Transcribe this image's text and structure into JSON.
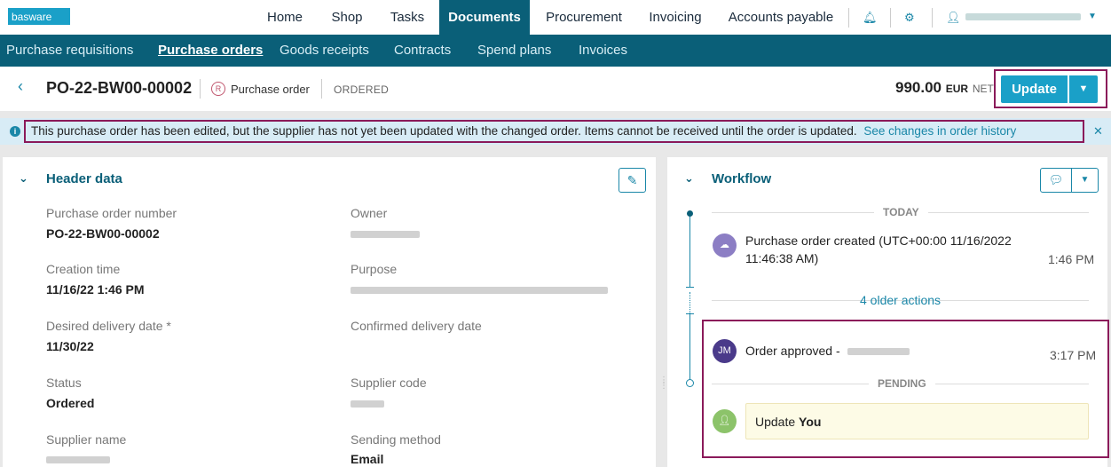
{
  "app": {
    "logo": "basware"
  },
  "topnav": {
    "items": [
      "Home",
      "Shop",
      "Tasks",
      "Documents",
      "Procurement",
      "Invoicing",
      "Accounts payable"
    ],
    "active": "Documents"
  },
  "subnav": {
    "items": [
      "Purchase requisitions",
      "Purchase orders",
      "Goods receipts",
      "Contracts",
      "Spend plans",
      "Invoices"
    ],
    "active": "Purchase orders"
  },
  "document": {
    "number": "PO-22-BW00-00002",
    "type": "Purchase order",
    "status": "ORDERED",
    "amount": "990.00",
    "currency": "EUR",
    "net": "NET",
    "update_label": "Update"
  },
  "banner": {
    "message": "This purchase order has been edited, but the supplier has not yet been updated with the changed order. Items cannot be received until the order is updated.",
    "link": "See changes in order history"
  },
  "header_data": {
    "title": "Header data",
    "fields": {
      "po_number_label": "Purchase order number",
      "po_number": "PO-22-BW00-00002",
      "owner_label": "Owner",
      "creation_label": "Creation time",
      "creation": "11/16/22 1:46 PM",
      "purpose_label": "Purpose",
      "desired_label": "Desired delivery date *",
      "desired": "11/30/22",
      "confirmed_label": "Confirmed delivery date",
      "status_label": "Status",
      "status": "Ordered",
      "supplier_code_label": "Supplier code",
      "supplier_name_label": "Supplier name",
      "sending_label": "Sending method",
      "sending": "Email"
    }
  },
  "workflow": {
    "title": "Workflow",
    "today_label": "TODAY",
    "created_line1": "Purchase order created (UTC+00:00 11/16/2022",
    "created_line2": "11:46:38 AM)",
    "created_time": "1:46 PM",
    "older_actions": "4 older actions",
    "approved_avatar": "JM",
    "approved_text": "Order approved -",
    "approved_time": "3:17 PM",
    "pending_label": "PENDING",
    "pending_action": "Update",
    "pending_who": "You"
  },
  "colors": {
    "brand": "#0a5f78",
    "accent": "#1aa0c8",
    "highlight": "#8b1a5a"
  }
}
